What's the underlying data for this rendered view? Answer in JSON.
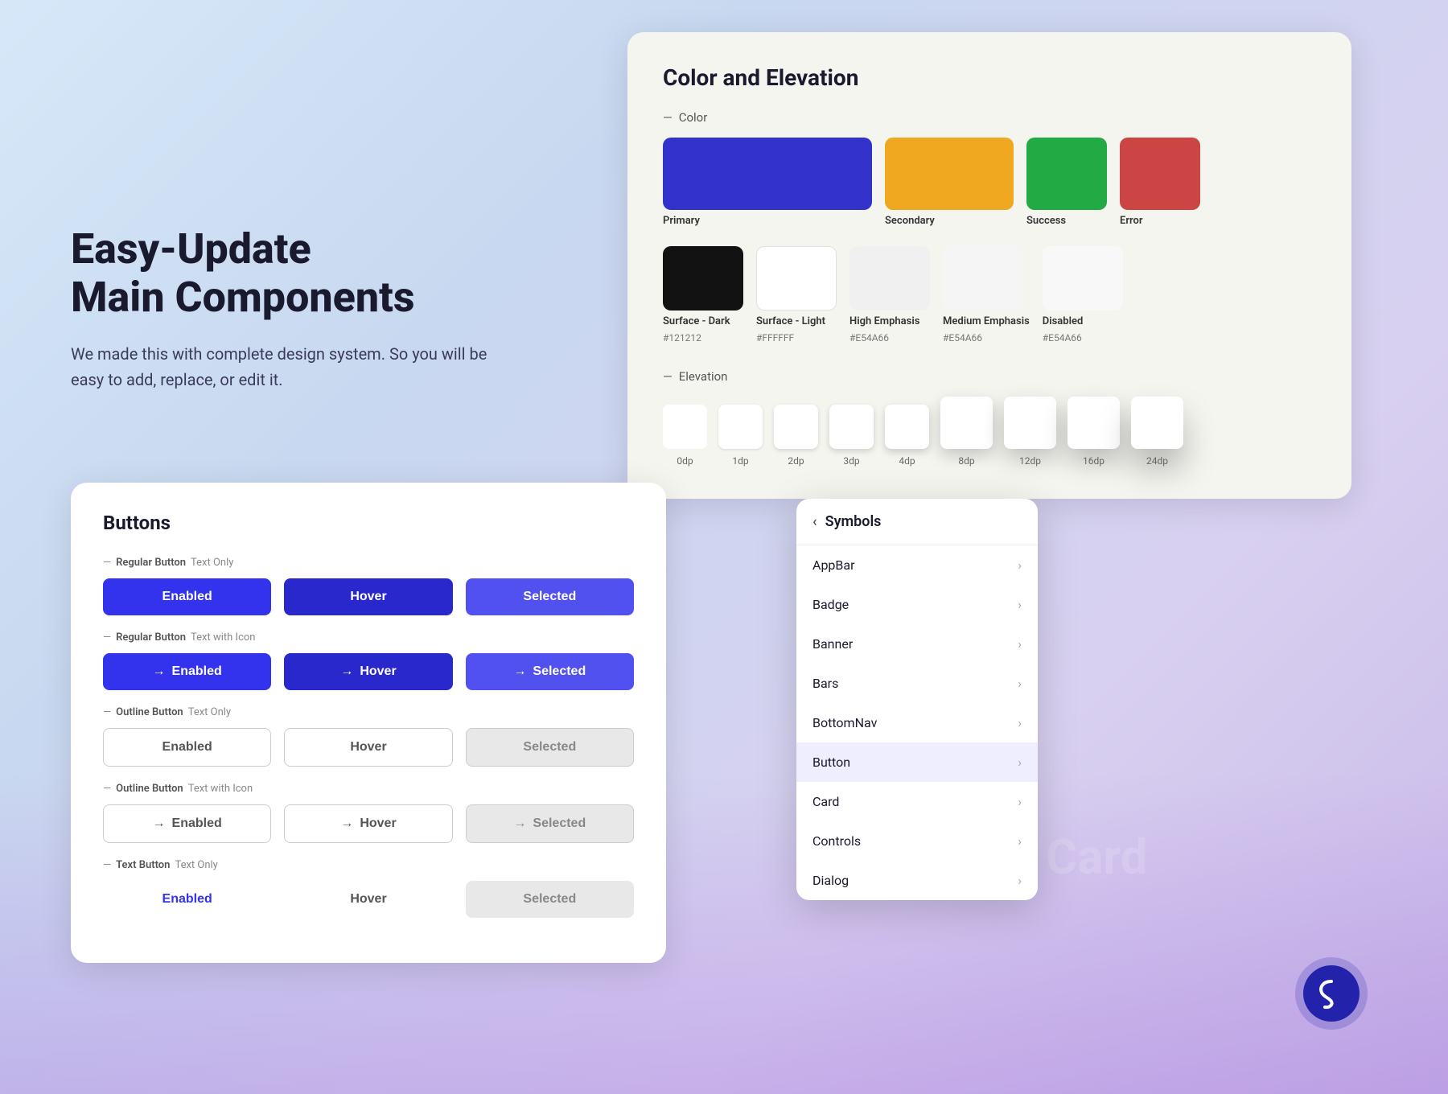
{
  "hero": {
    "title": "Easy-Update\nMain Components",
    "subtitle": "We made this with complete design system. So you will be easy to add, replace, or edit it."
  },
  "color_elevation_card": {
    "title": "Color and Elevation",
    "color_section_label": "Color",
    "elevation_section_label": "Elevation",
    "colors": [
      {
        "name": "Primary",
        "hex": "",
        "class": "swatch-primary"
      },
      {
        "name": "Secondary",
        "hex": "",
        "class": "swatch-secondary"
      },
      {
        "name": "Success",
        "hex": "",
        "class": "swatch-success"
      },
      {
        "name": "Error",
        "hex": "",
        "class": "swatch-error"
      }
    ],
    "surface_colors": [
      {
        "name": "Surface - Dark",
        "hex": "#121212",
        "class": "swatch-dark"
      },
      {
        "name": "Surface - Light",
        "hex": "#FFFFFF",
        "class": "swatch-light"
      },
      {
        "name": "High Emphasis",
        "hex": "#E54A66",
        "class": "swatch-high-emphasis"
      },
      {
        "name": "Medium Emphasis",
        "hex": "#E54A66",
        "class": "swatch-medium-emphasis"
      },
      {
        "name": "Disabled",
        "hex": "#E54A66",
        "class": "swatch-disabled"
      }
    ],
    "elevation_levels": [
      {
        "label": "0dp",
        "class": "elev-0dp"
      },
      {
        "label": "1dp",
        "class": "elev-1dp"
      },
      {
        "label": "2dp",
        "class": "elev-2dp"
      },
      {
        "label": "3dp",
        "class": "elev-3dp"
      },
      {
        "label": "4dp",
        "class": "elev-4dp"
      },
      {
        "label": "8dp",
        "class": "elev-8dp"
      },
      {
        "label": "12dp",
        "class": "elev-12dp"
      },
      {
        "label": "16dp",
        "class": "elev-16dp"
      },
      {
        "label": "24dp",
        "class": "elev-24dp"
      }
    ]
  },
  "buttons_card": {
    "title": "Buttons",
    "sections": [
      {
        "label_bold": "Regular Button",
        "label_regular": "Text Only",
        "buttons": [
          {
            "text": "Enabled",
            "variant": "btn-primary-enabled",
            "has_icon": false
          },
          {
            "text": "Hover",
            "variant": "btn-primary-hover",
            "has_icon": false
          },
          {
            "text": "Selected",
            "variant": "btn-primary-selected",
            "has_icon": false
          }
        ]
      },
      {
        "label_bold": "Regular Button",
        "label_regular": "Text with Icon",
        "buttons": [
          {
            "text": "Enabled",
            "variant": "btn-primary-enabled",
            "has_icon": true
          },
          {
            "text": "Hover",
            "variant": "btn-primary-hover",
            "has_icon": true
          },
          {
            "text": "Selected",
            "variant": "btn-primary-selected",
            "has_icon": true
          }
        ]
      },
      {
        "label_bold": "Outline Button",
        "label_regular": "Text Only",
        "buttons": [
          {
            "text": "Enabled",
            "variant": "btn-outline-enabled",
            "has_icon": false
          },
          {
            "text": "Hover",
            "variant": "btn-outline-hover",
            "has_icon": false
          },
          {
            "text": "Selected",
            "variant": "btn-outline-selected",
            "has_icon": false
          }
        ]
      },
      {
        "label_bold": "Outline Button",
        "label_regular": "Text with Icon",
        "buttons": [
          {
            "text": "Enabled",
            "variant": "btn-outline-enabled",
            "has_icon": true
          },
          {
            "text": "Hover",
            "variant": "btn-outline-hover",
            "has_icon": true
          },
          {
            "text": "Selected",
            "variant": "btn-outline-selected",
            "has_icon": true
          }
        ]
      },
      {
        "label_bold": "Text Button",
        "label_regular": "Text Only",
        "buttons": [
          {
            "text": "Enabled",
            "variant": "btn-text-enabled",
            "has_icon": false
          },
          {
            "text": "Hover",
            "variant": "btn-text-hover",
            "has_icon": false
          },
          {
            "text": "Selected",
            "variant": "btn-text-selected",
            "has_icon": false
          }
        ]
      }
    ]
  },
  "symbols_dropdown": {
    "header": "Symbols",
    "items": [
      {
        "label": "AppBar",
        "active": false
      },
      {
        "label": "Badge",
        "active": false
      },
      {
        "label": "Banner",
        "active": false
      },
      {
        "label": "Bars",
        "active": false
      },
      {
        "label": "BottomNav",
        "active": false
      },
      {
        "label": "Button",
        "active": true
      },
      {
        "label": "Card",
        "active": false
      },
      {
        "label": "Controls",
        "active": false
      },
      {
        "label": "Dialog",
        "active": false
      }
    ]
  },
  "card_label": "Card",
  "logo": "S"
}
